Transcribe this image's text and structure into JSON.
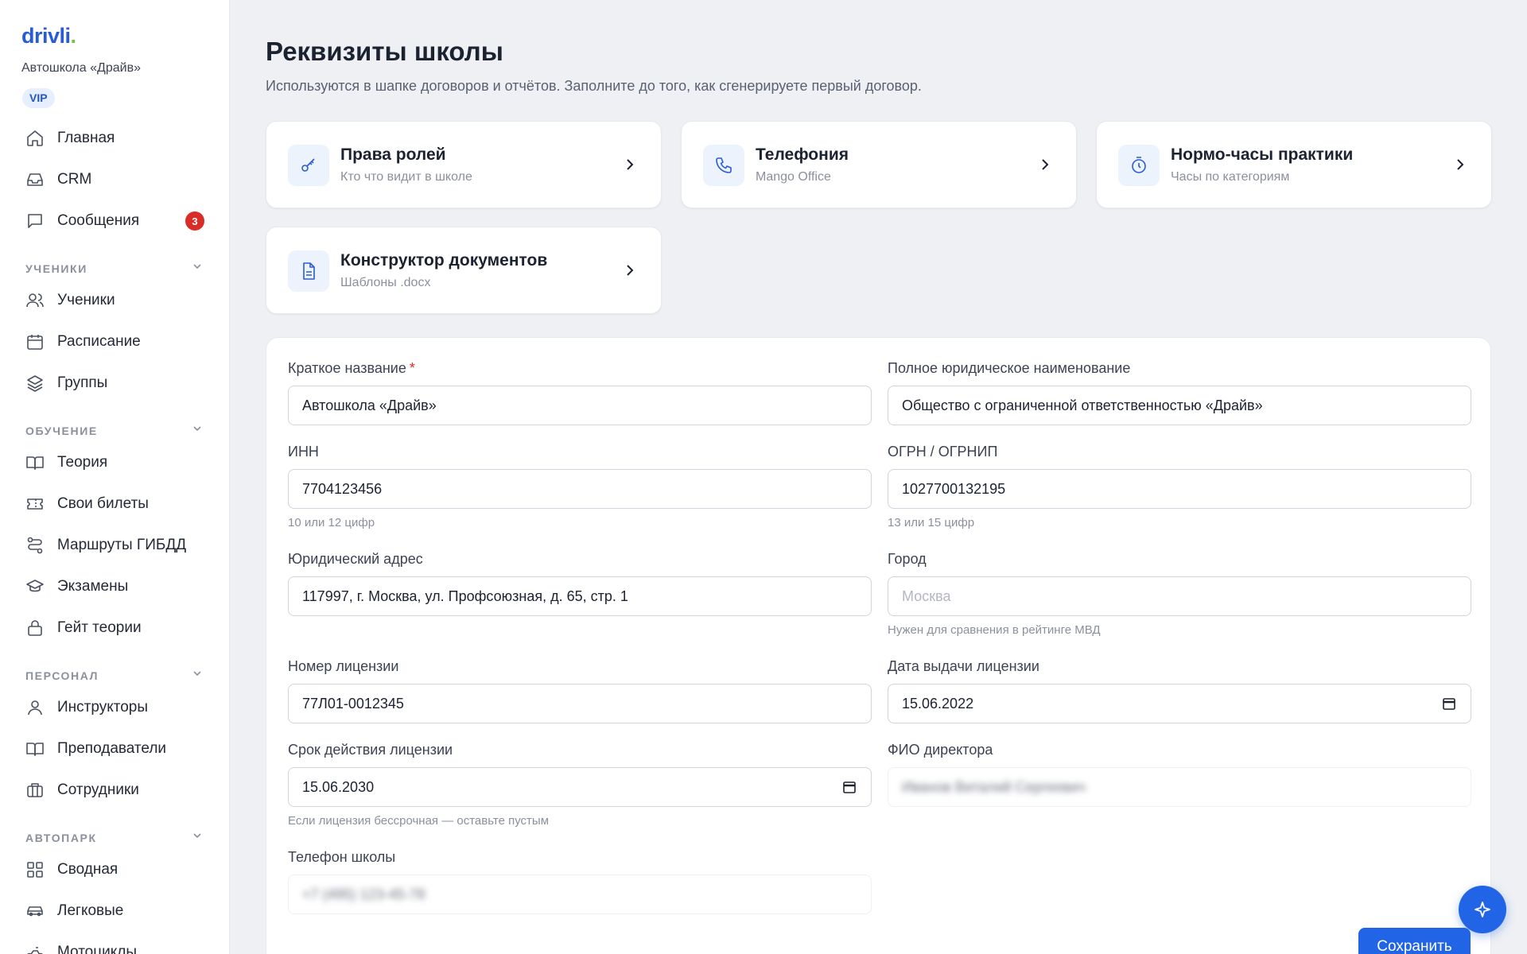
{
  "sidebar": {
    "logo": "drivli",
    "logo_dot": ".",
    "school_name": "Автошкола «Драйв»",
    "vip": "VIP",
    "top_items": [
      {
        "label": "Главная",
        "icon": "home-icon"
      },
      {
        "label": "CRM",
        "icon": "inbox-icon"
      },
      {
        "label": "Сообщения",
        "icon": "message-icon",
        "badge": "3"
      }
    ],
    "sections": [
      {
        "title": "УЧЕНИКИ",
        "items": [
          {
            "label": "Ученики",
            "icon": "users-icon"
          },
          {
            "label": "Расписание",
            "icon": "calendar-icon"
          },
          {
            "label": "Группы",
            "icon": "layers-icon"
          }
        ]
      },
      {
        "title": "ОБУЧЕНИЕ",
        "items": [
          {
            "label": "Теория",
            "icon": "book-icon"
          },
          {
            "label": "Свои билеты",
            "icon": "ticket-icon"
          },
          {
            "label": "Маршруты ГИБДД",
            "icon": "route-icon"
          },
          {
            "label": "Экзамены",
            "icon": "graduation-cap-icon"
          },
          {
            "label": "Гейт теории",
            "icon": "lock-icon"
          }
        ]
      },
      {
        "title": "ПЕРСОНАЛ",
        "items": [
          {
            "label": "Инструкторы",
            "icon": "user-icon"
          },
          {
            "label": "Преподаватели",
            "icon": "book-open-icon"
          },
          {
            "label": "Сотрудники",
            "icon": "briefcase-icon"
          }
        ]
      },
      {
        "title": "АВТОПАРК",
        "items": [
          {
            "label": "Сводная",
            "icon": "grid-icon"
          },
          {
            "label": "Легковые",
            "icon": "car-icon"
          },
          {
            "label": "Мотоциклы",
            "icon": "motorcycle-icon"
          }
        ]
      }
    ]
  },
  "header": {
    "title": "Реквизиты школы",
    "subtitle": "Используются в шапке договоров и отчётов. Заполните до того, как сгенерируете первый договор."
  },
  "cards": [
    {
      "title": "Права ролей",
      "subtitle": "Кто что видит в школе",
      "icon": "key-icon"
    },
    {
      "title": "Телефония",
      "subtitle": "Mango Office",
      "icon": "phone-icon"
    },
    {
      "title": "Нормо-часы практики",
      "subtitle": "Часы по категориям",
      "icon": "timer-icon"
    },
    {
      "title": "Конструктор документов",
      "subtitle": "Шаблоны .docx",
      "icon": "document-icon"
    }
  ],
  "form": {
    "short_name": {
      "label": "Краткое название",
      "required_mark": "*",
      "value": "Автошкола «Драйв»"
    },
    "full_name": {
      "label": "Полное юридическое наименование",
      "value": "Общество с ограниченной ответственностью «Драйв»"
    },
    "inn": {
      "label": "ИНН",
      "value": "7704123456",
      "hint": "10 или 12 цифр"
    },
    "ogrn": {
      "label": "ОГРН / ОГРНИП",
      "value": "1027700132195",
      "hint": "13 или 15 цифр"
    },
    "address": {
      "label": "Юридический адрес",
      "value": "117997, г. Москва, ул. Профсоюзная, д. 65, стр. 1"
    },
    "city": {
      "label": "Город",
      "placeholder": "Москва",
      "hint": "Нужен для сравнения в рейтинге МВД"
    },
    "license_number": {
      "label": "Номер лицензии",
      "value": "77Л01-0012345"
    },
    "license_date": {
      "label": "Дата выдачи лицензии",
      "value": "15.06.2022"
    },
    "license_expiry": {
      "label": "Срок действия лицензии",
      "value": "15.06.2030",
      "hint": "Если лицензия бессрочная — оставьте пустым"
    },
    "director": {
      "label": "ФИО директора",
      "value": "Иванов Виталий Сергеевич"
    },
    "phone": {
      "label": "Телефон школы",
      "value": "+7 (495) 123-45-78"
    }
  },
  "actions": {
    "save": "Сохранить"
  },
  "colors": {
    "accent": "#2264e6",
    "badge": "#d92d27",
    "logo": "#2a5bd7",
    "logo_dot": "#7ac143"
  }
}
